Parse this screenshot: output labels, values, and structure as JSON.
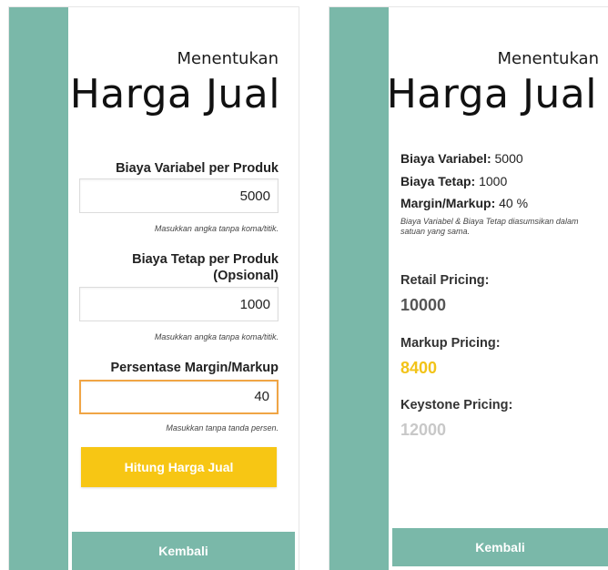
{
  "left_screen": {
    "title_small": "Menentukan",
    "title_big": "Harga Jual",
    "fields": [
      {
        "label": "Biaya Variabel per Produk",
        "value": "5000",
        "hint": "Masukkan angka tanpa koma/titik."
      },
      {
        "label_line1": "Biaya Tetap per Produk",
        "label_line2": "(Opsional)",
        "value": "1000",
        "hint": "Masukkan angka tanpa koma/titik."
      },
      {
        "label": "Persentase Margin/Markup",
        "value": "40",
        "hint": "Masukkan tanpa tanda persen."
      }
    ],
    "calculate_button": "Hitung Harga Jual",
    "back_button": "Kembali"
  },
  "right_screen": {
    "title_small": "Menentukan",
    "title_big": "Harga Jual",
    "summary": {
      "variable_label": "Biaya Variabel:",
      "variable_value": "5000",
      "fixed_label": "Biaya Tetap:",
      "fixed_value": "1000",
      "margin_label": "Margin/Markup:",
      "margin_value": "40 %"
    },
    "note": "Biaya Variabel & Biaya Tetap diasumsikan dalam satuan yang sama.",
    "results": [
      {
        "label": "Retail Pricing:",
        "value": "10000",
        "color": "#555555"
      },
      {
        "label": "Markup Pricing:",
        "value": "8400",
        "color": "#f2c318"
      },
      {
        "label": "Keystone Pricing:",
        "value": "12000",
        "color": "#c8c8c8"
      }
    ],
    "back_button": "Kembali"
  },
  "colors": {
    "accent_teal": "#7ab8a9",
    "button_yellow": "#f7c614",
    "active_input_border": "#f0a545"
  }
}
